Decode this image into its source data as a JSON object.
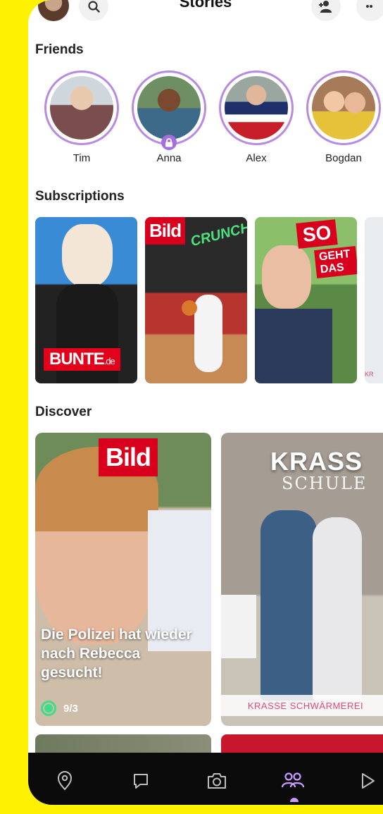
{
  "header": {
    "title": "Stories"
  },
  "sections": {
    "friends": "Friends",
    "subscriptions": "Subscriptions",
    "discover": "Discover"
  },
  "friends": [
    {
      "name": "Tim"
    },
    {
      "name": "Anna",
      "locked": true
    },
    {
      "name": "Alex"
    },
    {
      "name": "Bogdan"
    }
  ],
  "subscriptions": [
    {
      "brand": "BUNTE",
      "suffix": ".de"
    },
    {
      "brand": "Bild",
      "headline": "CRUNCH"
    },
    {
      "brand": "SO",
      "sub": "GEHT DAS"
    },
    {
      "brand": "KR"
    }
  ],
  "discover": [
    {
      "brand": "Bild",
      "caption": "Die Polizei hat wieder nach Rebecca gesucht!",
      "meta": "9/3"
    },
    {
      "title": "KRASS",
      "subtitle": "SCHULE",
      "strip": "KRASSE SCHWÄRMEREI"
    }
  ],
  "colors": {
    "background": "#FFF200",
    "accent": "#b68be0",
    "nav_active": "#c79bff",
    "nav_bg": "#0b0b0b"
  },
  "nav": [
    {
      "icon": "map-pin-icon"
    },
    {
      "icon": "chat-icon"
    },
    {
      "icon": "camera-icon"
    },
    {
      "icon": "friends-icon",
      "active": true
    },
    {
      "icon": "play-icon"
    }
  ]
}
